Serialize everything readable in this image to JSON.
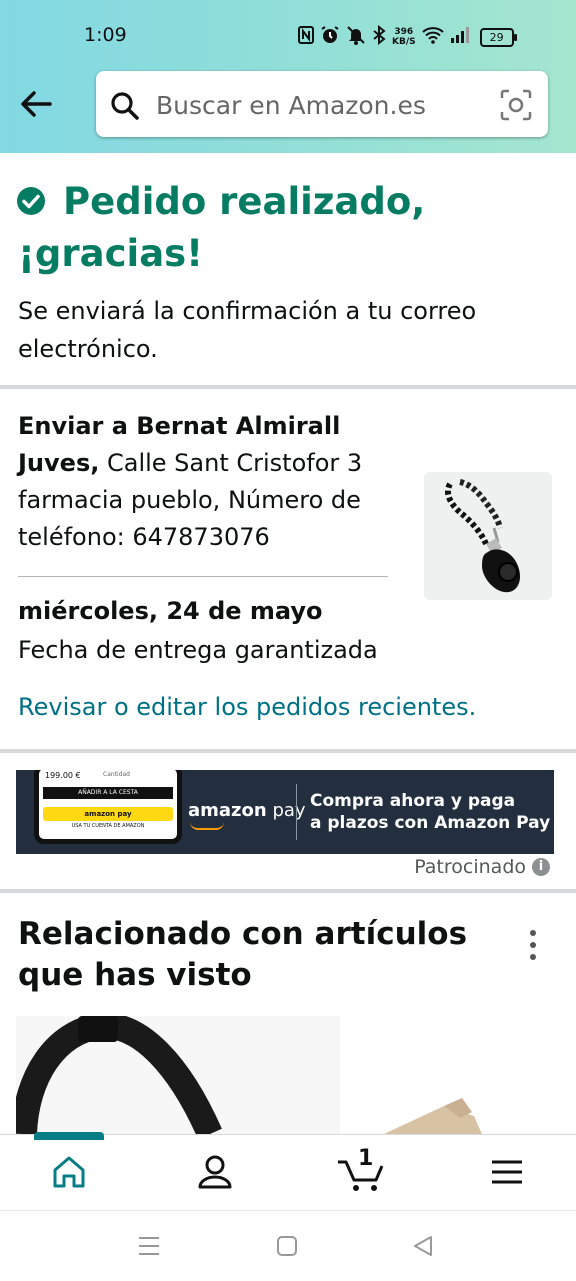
{
  "status_bar": {
    "time": "1:09",
    "speed_value": "396",
    "speed_unit": "KB/S",
    "battery": "29"
  },
  "search": {
    "placeholder": "Buscar en Amazon.es"
  },
  "confirmation": {
    "title": "Pedido realizado, ¡gracias!",
    "message": "Se enviará la confirmación a tu correo electrónico."
  },
  "shipping": {
    "prefix": "Enviar a Bernat Almirall Juves,",
    "address": " Calle Sant Cristofor 3 farmacia pueblo, Número de teléfono: 647873076",
    "delivery_date": "miércoles, 24 de mayo",
    "delivery_note": "Fecha de entrega garantizada",
    "review_link": "Revisar o editar los pedidos recientes."
  },
  "ad": {
    "phone_price": "199.00 €",
    "phone_qty": "Cantidad",
    "phone_cart": "AÑADIR A LA CESTA",
    "phone_pay_button": "amazon pay",
    "phone_pay_caption": "USA TU CUENTA DE AMAZON",
    "logo_bold": "amazon",
    "logo_light": " pay",
    "line1": "Compra ahora y paga",
    "line2": "a plazos con Amazon Pay",
    "sponsored_label": "Patrocinado"
  },
  "related": {
    "title": "Relacionado con artículos que has visto"
  },
  "bottom_nav": {
    "cart_count": "1"
  },
  "colors": {
    "accent_green": "#067d62",
    "link_teal": "#007185",
    "ad_background": "#232f3e"
  }
}
